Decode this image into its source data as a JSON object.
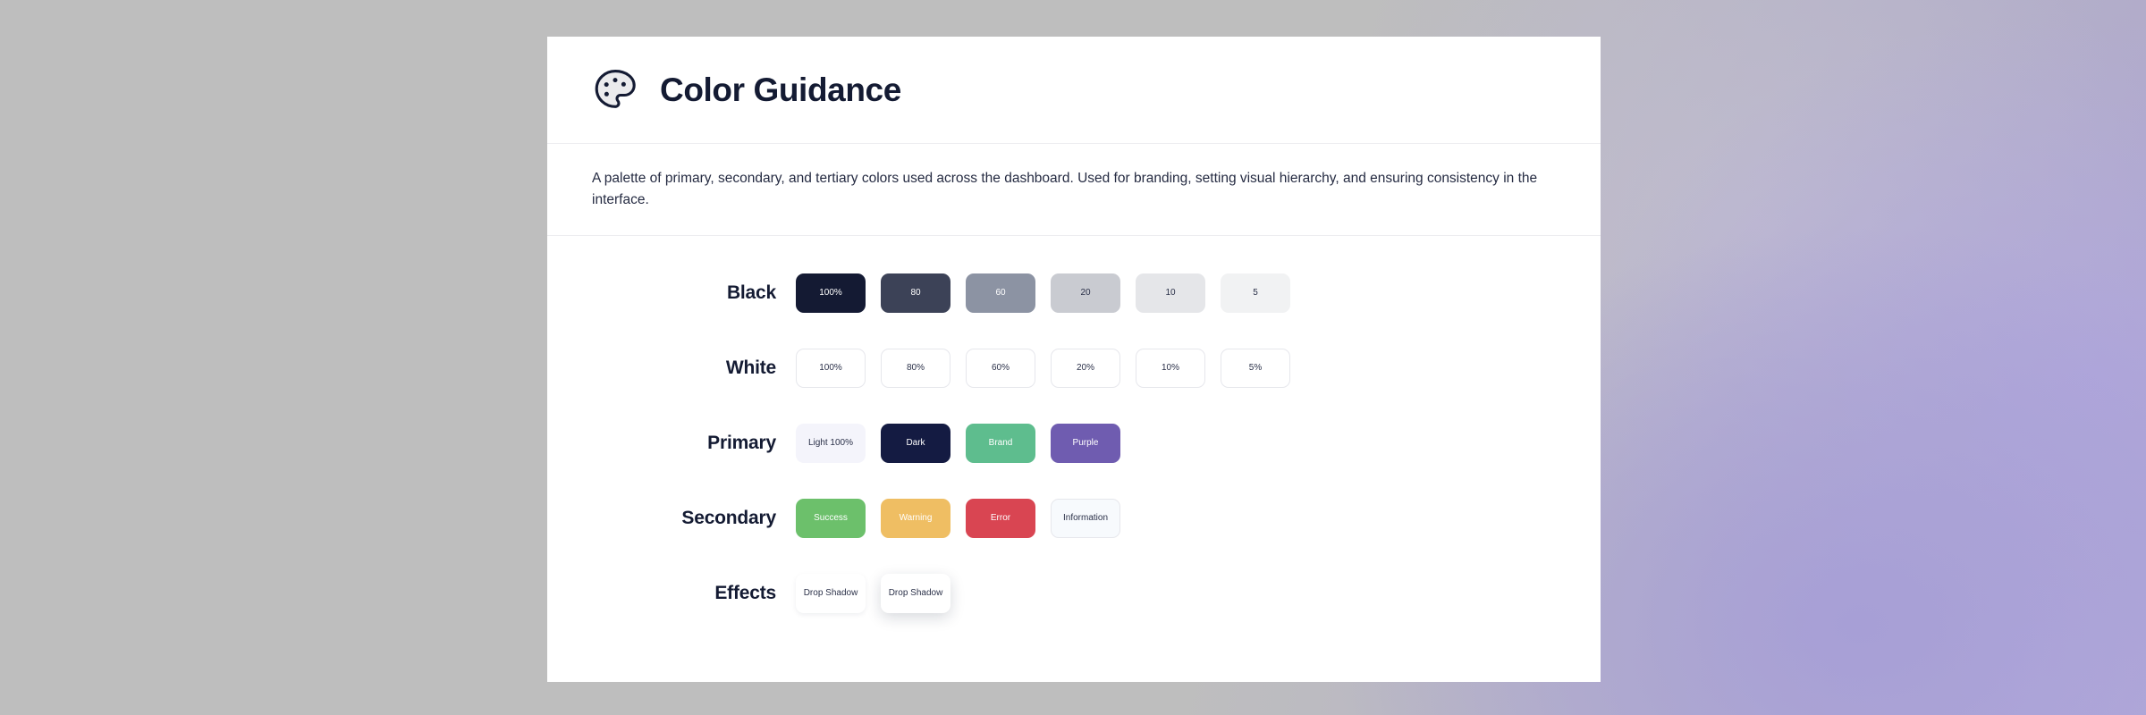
{
  "header": {
    "title": "Color Guidance",
    "icon": "palette-icon"
  },
  "description": "A palette of primary, secondary, and tertiary colors used across the dashboard. Used for branding, setting visual hierarchy, and ensuring consistency in the interface.",
  "rows": [
    {
      "label": "Black",
      "swatches": [
        {
          "label": "100%",
          "bg": "#141a33",
          "fg": "#ffffff",
          "style": "solid"
        },
        {
          "label": "80",
          "bg": "#3c4257",
          "fg": "#ffffff",
          "style": "solid"
        },
        {
          "label": "60",
          "bg": "#8c93a3",
          "fg": "#ffffff",
          "style": "solid"
        },
        {
          "label": "20",
          "bg": "#c9cbd1",
          "fg": "#2b3149",
          "style": "solid"
        },
        {
          "label": "10",
          "bg": "#e5e6e9",
          "fg": "#2b3149",
          "style": "solid"
        },
        {
          "label": "5",
          "bg": "#f1f2f3",
          "fg": "#2b3149",
          "style": "solid"
        }
      ]
    },
    {
      "label": "White",
      "swatches": [
        {
          "label": "100%",
          "bg": "#ffffff",
          "fg": "#2b3149",
          "style": "ghost"
        },
        {
          "label": "80%",
          "bg": "#ffffff",
          "fg": "#2b3149",
          "style": "ghost"
        },
        {
          "label": "60%",
          "bg": "#ffffff",
          "fg": "#2b3149",
          "style": "ghost"
        },
        {
          "label": "20%",
          "bg": "#ffffff",
          "fg": "#2b3149",
          "style": "ghost"
        },
        {
          "label": "10%",
          "bg": "#ffffff",
          "fg": "#2b3149",
          "style": "ghost"
        },
        {
          "label": "5%",
          "bg": "#ffffff",
          "fg": "#2b3149",
          "style": "ghost"
        }
      ]
    },
    {
      "label": "Primary",
      "swatches": [
        {
          "label": "Light 100%",
          "bg": "#f4f4fb",
          "fg": "#2b3149",
          "style": "solid"
        },
        {
          "label": "Dark",
          "bg": "#141b42",
          "fg": "#ffffff",
          "style": "solid"
        },
        {
          "label": "Brand",
          "bg": "#5ebd8e",
          "fg": "#ffffff",
          "style": "solid"
        },
        {
          "label": "Purple",
          "bg": "#6f5cb0",
          "fg": "#ffffff",
          "style": "solid"
        }
      ]
    },
    {
      "label": "Secondary",
      "swatches": [
        {
          "label": "Success",
          "bg": "#6cc06b",
          "fg": "#ffffff",
          "style": "solid"
        },
        {
          "label": "Warning",
          "bg": "#efbe63",
          "fg": "#ffffff",
          "style": "solid"
        },
        {
          "label": "Error",
          "bg": "#d94552",
          "fg": "#ffffff",
          "style": "solid"
        },
        {
          "label": "Information",
          "bg": "#f7fafd",
          "fg": "#2b3149",
          "style": "ghost"
        }
      ]
    },
    {
      "label": "Effects",
      "swatches": [
        {
          "label": "Drop Shadow",
          "bg": "#ffffff",
          "fg": "#2b3149",
          "style": "shadow-soft"
        },
        {
          "label": "Drop Shadow",
          "bg": "#ffffff",
          "fg": "#2b3149",
          "style": "shadow-strong"
        }
      ]
    }
  ]
}
